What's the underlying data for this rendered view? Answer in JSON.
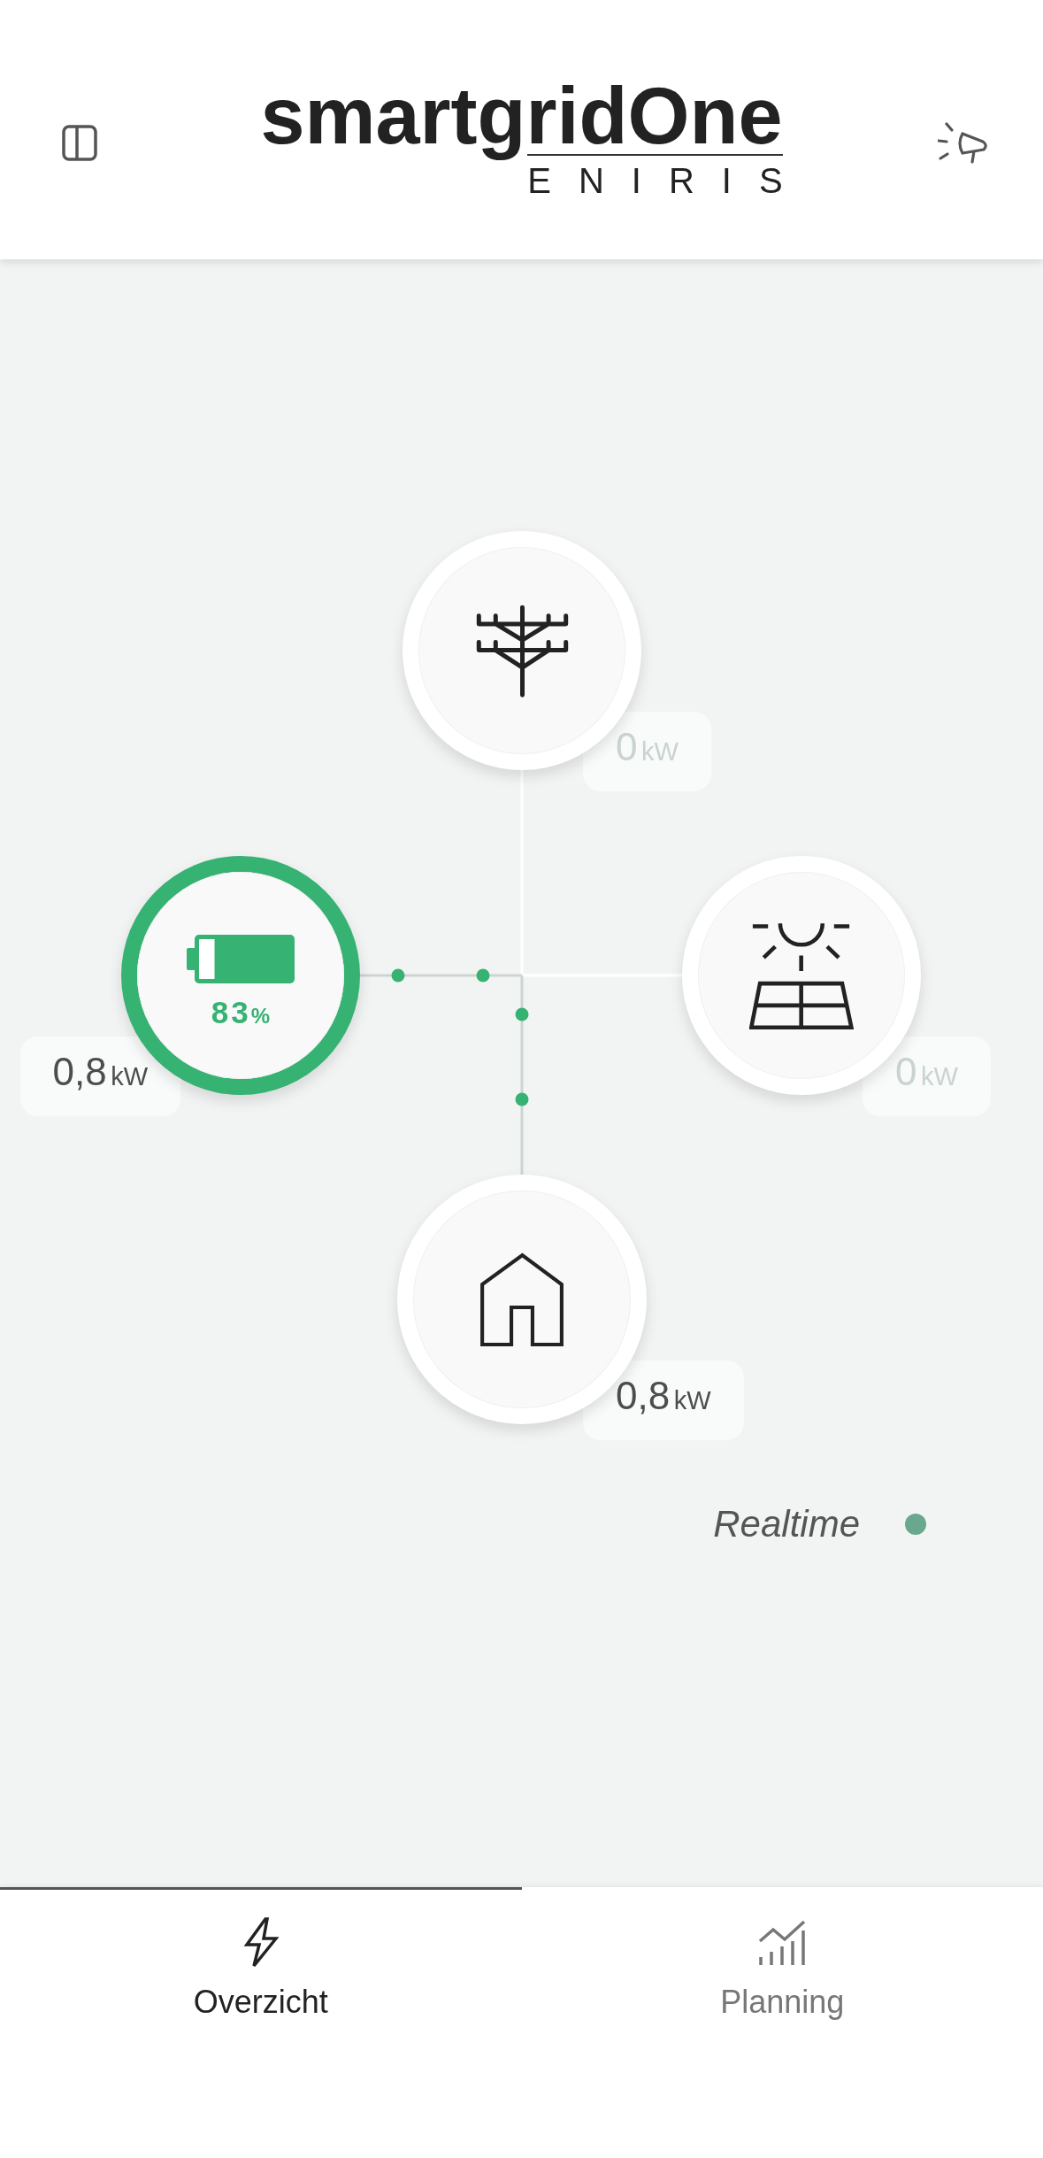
{
  "header": {
    "logo_wordmark": "smartgridOne",
    "logo_tagline": "ENIRIS"
  },
  "nodes": [
    {
      "kind": "grid",
      "active": false,
      "value": "0",
      "unit": "kW"
    },
    {
      "kind": "battery",
      "active": true,
      "value": "0,8",
      "unit": "kW",
      "level": 0.83,
      "charge": "83",
      "charge_unit": "%"
    },
    {
      "kind": "solar",
      "active": false,
      "value": "0",
      "unit": "kW"
    },
    {
      "kind": "home",
      "active": true,
      "value": "0,8",
      "unit": "kW"
    }
  ],
  "status": {
    "label": "Realtime",
    "live": true
  },
  "tabs": [
    {
      "label": "Overzicht",
      "selected": true
    },
    {
      "label": "Planning",
      "selected": false
    }
  ]
}
